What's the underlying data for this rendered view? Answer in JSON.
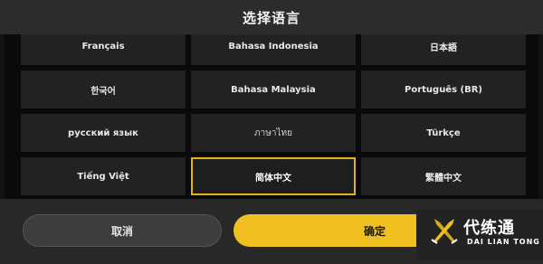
{
  "dialog": {
    "title": "选择语言",
    "languages": [
      {
        "label": "Français"
      },
      {
        "label": "Bahasa Indonesia"
      },
      {
        "label": "日本語"
      },
      {
        "label": "한국어"
      },
      {
        "label": "Bahasa Malaysia"
      },
      {
        "label": "Português (BR)"
      },
      {
        "label": "русский язык"
      },
      {
        "label": "ภาษาไทย"
      },
      {
        "label": "Türkçe"
      },
      {
        "label": "Tiếng Việt"
      },
      {
        "label": "简体中文"
      },
      {
        "label": "繁體中文"
      }
    ],
    "selected_language": "简体中文",
    "cancel_label": "取消",
    "confirm_label": "确定"
  },
  "watermark": {
    "name": "代练通",
    "subtitle": "DAI LIAN TONG"
  },
  "colors": {
    "accent": "#f0c020",
    "selected_border": "#e6b21c",
    "cell_bg": "#222222",
    "title_bar_bg": "#2c2c2c"
  }
}
